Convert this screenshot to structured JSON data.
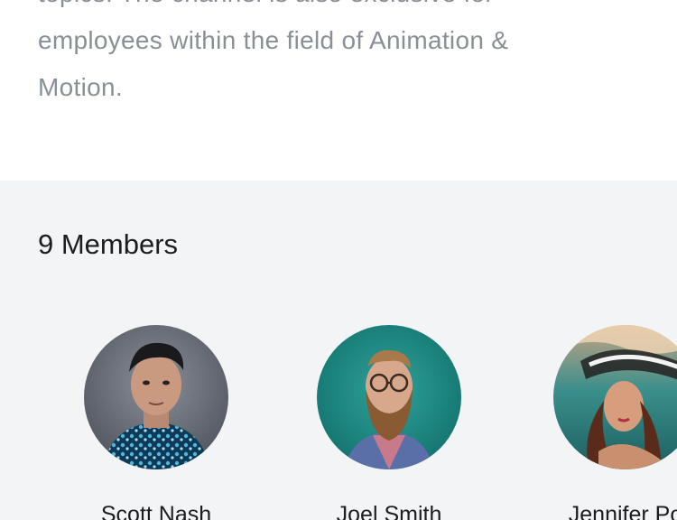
{
  "channel": {
    "description": "topics. The channel is also exclusive for employees within the field of Animation & Motion."
  },
  "members": {
    "heading": "9 Members",
    "list": [
      {
        "name": "Scott Nash",
        "avatar_icon": "avatar-photo"
      },
      {
        "name": "Joel Smith",
        "avatar_icon": "avatar-photo"
      },
      {
        "name": "Jennifer Po",
        "avatar_icon": "avatar-photo"
      }
    ]
  }
}
